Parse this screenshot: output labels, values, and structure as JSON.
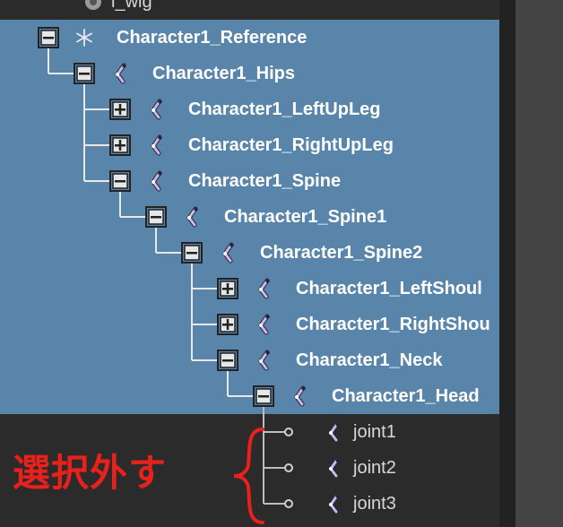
{
  "outliner": {
    "top_partial_item": {
      "label": "l_wig",
      "icon": "group-gear-icon"
    },
    "items": [
      {
        "label": "Character1_Reference",
        "expander": "minus",
        "icon": "locator-star-icon",
        "selected": true
      },
      {
        "label": "Character1_Hips",
        "expander": "minus",
        "icon": "joint-icon",
        "selected": true
      },
      {
        "label": "Character1_LeftUpLeg",
        "expander": "plus",
        "icon": "joint-icon",
        "selected": true
      },
      {
        "label": "Character1_RightUpLeg",
        "expander": "plus",
        "icon": "joint-icon",
        "selected": true
      },
      {
        "label": "Character1_Spine",
        "expander": "minus",
        "icon": "joint-icon",
        "selected": true
      },
      {
        "label": "Character1_Spine1",
        "expander": "minus",
        "icon": "joint-icon",
        "selected": true
      },
      {
        "label": "Character1_Spine2",
        "expander": "minus",
        "icon": "joint-icon",
        "selected": true
      },
      {
        "label": "Character1_LeftShoul",
        "expander": "plus",
        "icon": "joint-icon",
        "selected": true
      },
      {
        "label": "Character1_RightShou",
        "expander": "plus",
        "icon": "joint-icon",
        "selected": true
      },
      {
        "label": "Character1_Neck",
        "expander": "minus",
        "icon": "joint-icon",
        "selected": true
      },
      {
        "label": "Character1_Head",
        "expander": "minus",
        "icon": "joint-icon",
        "selected": true
      },
      {
        "label": "joint1",
        "expander": "leaf",
        "icon": "joint-icon",
        "selected": false
      },
      {
        "label": "joint2",
        "expander": "leaf",
        "icon": "joint-icon",
        "selected": false
      },
      {
        "label": "joint3",
        "expander": "leaf",
        "icon": "joint-icon",
        "selected": false
      }
    ]
  },
  "annotation": {
    "text": "選択外す",
    "color": "#e8211c"
  },
  "colors": {
    "selection": "#5a85ab",
    "background": "#2b2b2b",
    "joint_icon": "#c9b8e8"
  }
}
